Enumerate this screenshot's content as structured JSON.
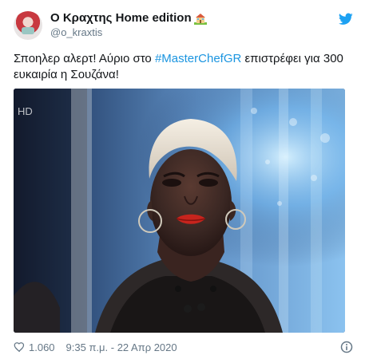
{
  "tweet": {
    "display_name": "Ο Κραχτης Home edition",
    "handle": "@o_kraxtis",
    "text_before": "Σποηλερ αλερτ! Αύριο στο ",
    "hashtag": "#MasterChefGR",
    "text_after": " επιστρέφει για 300 ευκαιρία η Σουζάνα!",
    "likes": "1.060",
    "timestamp": "9:35 π.μ. - 22 Απρ 2020"
  },
  "icons": {
    "avatar": "avatar",
    "house": "house-with-garden-emoji",
    "brand": "twitter-bird-icon",
    "likes": "heart-icon",
    "info": "info-icon",
    "media": "tweet-photo"
  },
  "colors": {
    "accent": "#1b95e0",
    "text": "#14171a",
    "muted": "#657786"
  }
}
